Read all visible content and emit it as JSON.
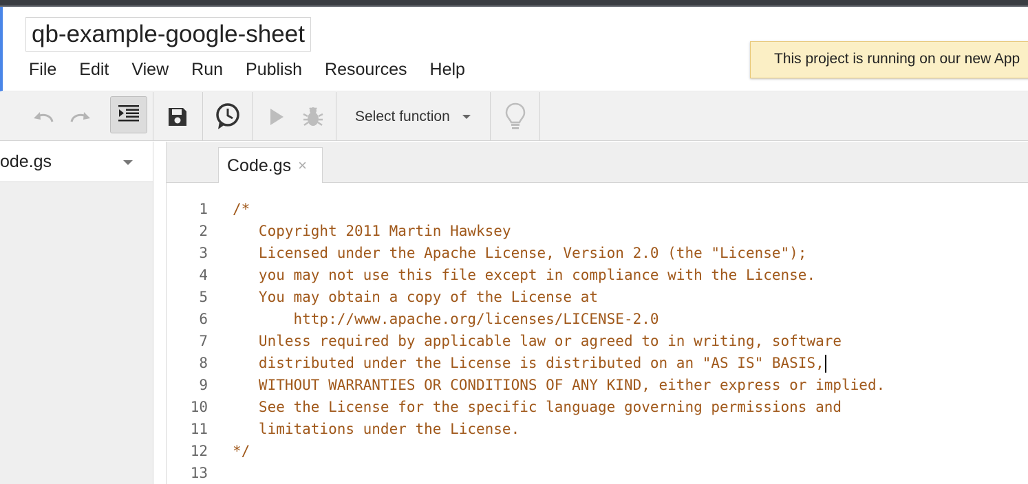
{
  "project": {
    "title": "qb-example-google-sheet"
  },
  "menu": [
    "File",
    "Edit",
    "View",
    "Run",
    "Publish",
    "Resources",
    "Help"
  ],
  "notice": {
    "text": "This project is running on our new App"
  },
  "toolbar": {
    "undo_icon": "undo-icon",
    "redo_icon": "redo-icon",
    "indent_icon": "indent-icon",
    "save_icon": "save-icon",
    "triggers_icon": "clock-icon",
    "run_icon": "play-icon",
    "debug_icon": "bug-icon",
    "select_function_label": "Select function",
    "hint_icon": "lightbulb-icon"
  },
  "sidebar": {
    "file_select_label": "ode.gs"
  },
  "tabs": [
    {
      "label": "Code.gs",
      "close": "×"
    }
  ],
  "editor": {
    "line_numbers": [
      "1",
      "2",
      "3",
      "4",
      "5",
      "6",
      "7",
      "8",
      "9",
      "10",
      "11",
      "12",
      "13"
    ],
    "lines": [
      "/*",
      "   Copyright 2011 Martin Hawksey",
      "   Licensed under the Apache License, Version 2.0 (the \"License\");",
      "   you may not use this file except in compliance with the License.",
      "   You may obtain a copy of the License at",
      "       http://www.apache.org/licenses/LICENSE-2.0",
      "   Unless required by applicable law or agreed to in writing, software",
      "   distributed under the License is distributed on an \"AS IS\" BASIS,",
      "   WITHOUT WARRANTIES OR CONDITIONS OF ANY KIND, either express or implied.",
      "   See the License for the specific language governing permissions and",
      "   limitations under the License.",
      "*/",
      ""
    ],
    "comment_color": "#a0581a"
  }
}
